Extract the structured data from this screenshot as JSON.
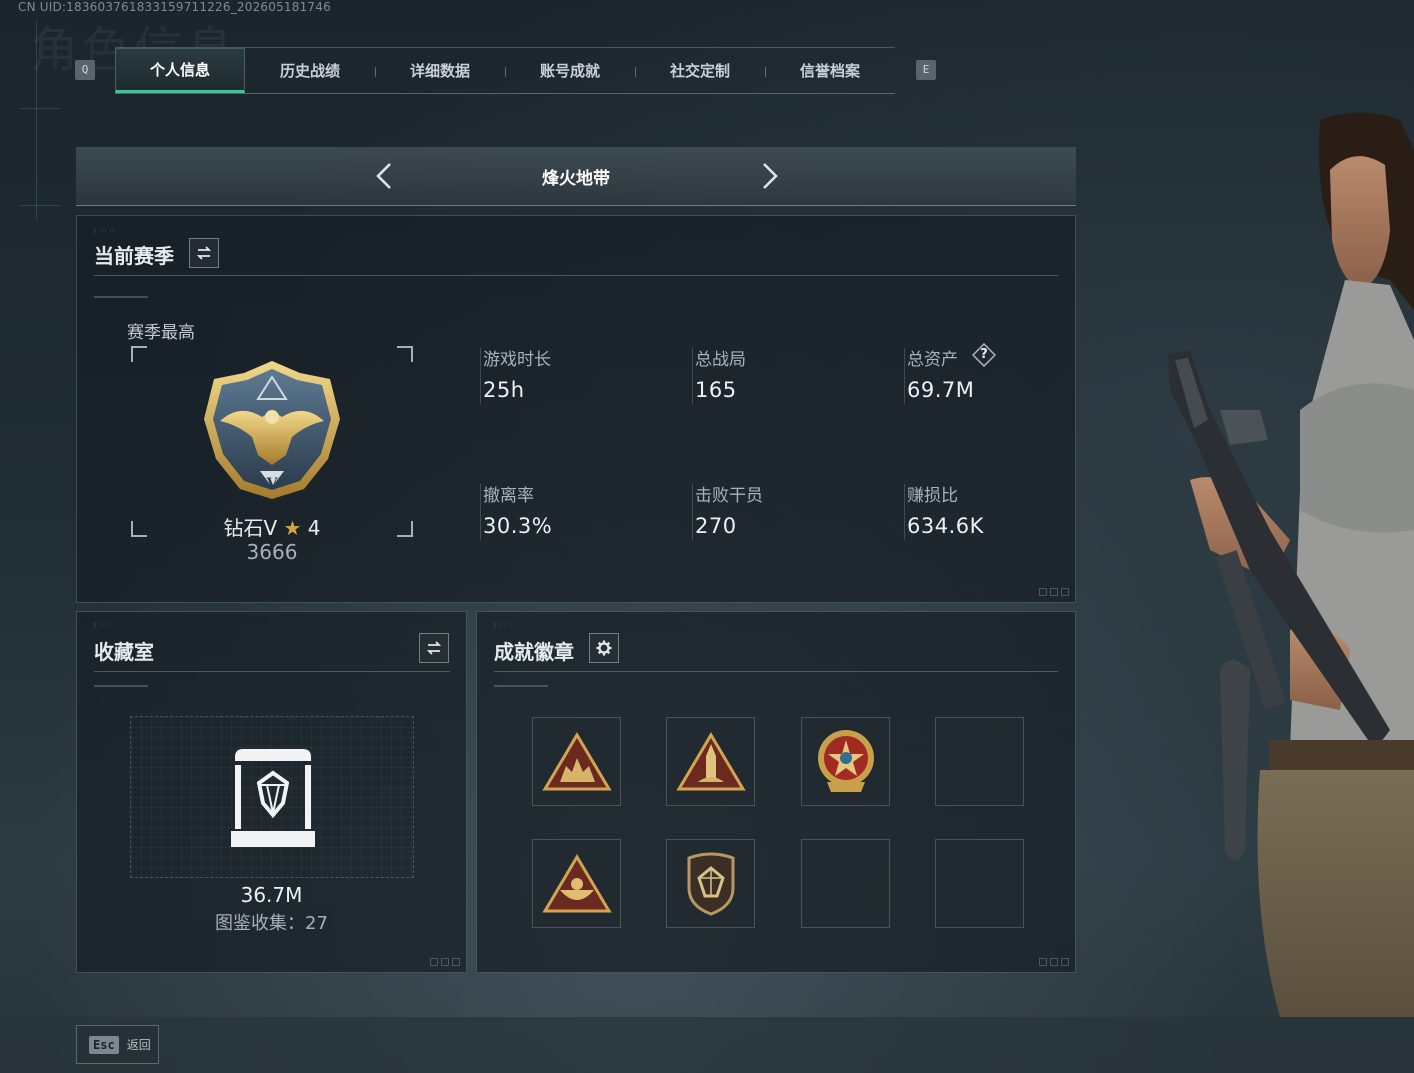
{
  "uid_text": "CN UID:183603761833159711226_202605181746",
  "watermark_title": "角色信息",
  "tabs": {
    "prev_key": "Q",
    "next_key": "E",
    "items": [
      {
        "label": "个人信息",
        "active": true
      },
      {
        "label": "历史战绩",
        "active": false
      },
      {
        "label": "详细数据",
        "active": false
      },
      {
        "label": "账号成就",
        "active": false
      },
      {
        "label": "社交定制",
        "active": false
      },
      {
        "label": "信誉档案",
        "active": false
      }
    ]
  },
  "mode": {
    "title": "烽火地带"
  },
  "season": {
    "title": "当前赛季",
    "best_label": "赛季最高",
    "rank_name": "钻石V",
    "rank_stars": "4",
    "rank_score": "3666",
    "stats": [
      {
        "label": "游戏时长",
        "value": "25h"
      },
      {
        "label": "总战局",
        "value": "165"
      },
      {
        "label": "总资产",
        "value": "69.7M",
        "has_help": true,
        "help_glyph": "?"
      },
      {
        "label": "撤离率",
        "value": "30.3%"
      },
      {
        "label": "击败干员",
        "value": "270"
      },
      {
        "label": "赚损比",
        "value": "634.6K"
      }
    ]
  },
  "collection": {
    "title": "收藏室",
    "value": "36.7M",
    "catalog_text": "图鉴收集：27"
  },
  "badges": {
    "title": "成就徽章",
    "slots": [
      {
        "icon": "badge-triangle-soldiers-icon",
        "filled": true
      },
      {
        "icon": "badge-triangle-rocket-icon",
        "filled": true
      },
      {
        "icon": "badge-round-star-icon",
        "filled": true
      },
      {
        "icon": "",
        "filled": false
      },
      {
        "icon": "badge-triangle-bowl-icon",
        "filled": true
      },
      {
        "icon": "badge-shield-diamond-icon",
        "filled": true
      },
      {
        "icon": "",
        "filled": false
      },
      {
        "icon": "",
        "filled": false
      }
    ]
  },
  "footer": {
    "esc_key": "Esc",
    "back_label": "返回"
  },
  "colors": {
    "accent": "#3ac894",
    "gold": "#c9a04a",
    "panel_bg": "#161e24"
  }
}
